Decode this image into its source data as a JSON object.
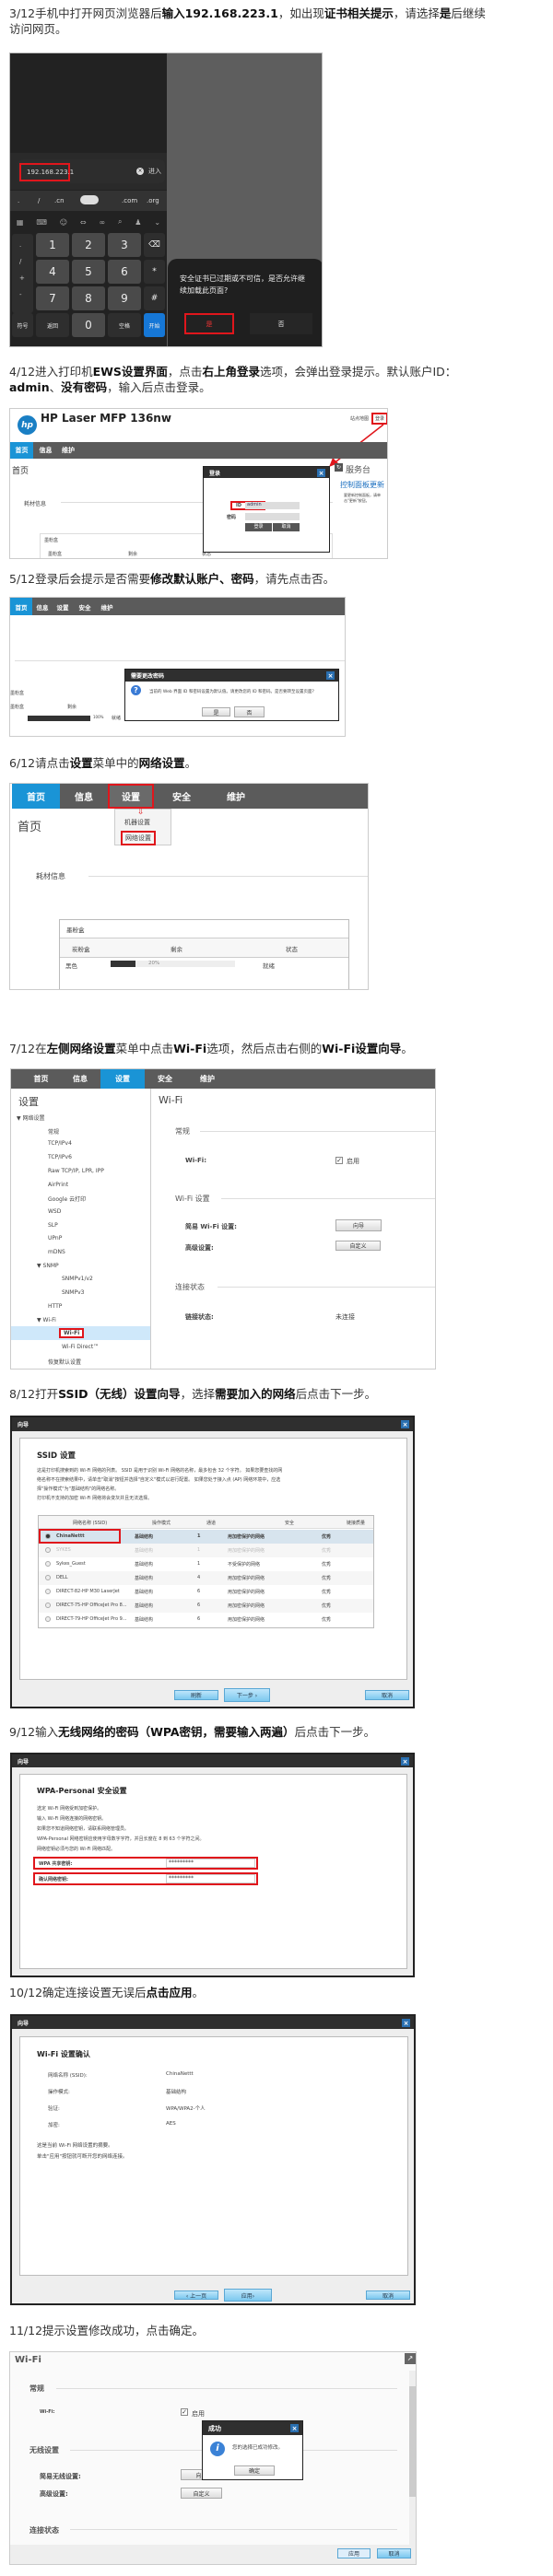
{
  "steps": [
    {
      "parts": [
        {
          "text": "3/12手机中打开网页浏览器后"
        },
        {
          "text": "输入192.168.223.1",
          "bold": true
        },
        {
          "text": "，如出现"
        },
        {
          "text": "证书相关提示",
          "bold": true
        },
        {
          "text": "，请选择"
        },
        {
          "text": "是",
          "bold": true
        },
        {
          "text": "后继续访问网页。"
        }
      ]
    },
    {
      "parts": [
        {
          "text": "4/12进入打印机"
        },
        {
          "text": "EWS设置界面",
          "bold": true
        },
        {
          "text": "，点击"
        },
        {
          "text": "右上角登录",
          "bold": true
        },
        {
          "text": "选项，会弹出登录提示。默认账户ID："
        },
        {
          "text": "admin",
          "bold": true
        },
        {
          "text": "、"
        },
        {
          "text": "没有密码",
          "bold": true
        },
        {
          "text": "，输入后点击登录。"
        }
      ]
    },
    {
      "parts": [
        {
          "text": "5/12登录后会提示是否需要"
        },
        {
          "text": "修改默认账户、密码",
          "bold": true
        },
        {
          "text": "，请先点击否。"
        }
      ]
    },
    {
      "parts": [
        {
          "text": "6/12请点击"
        },
        {
          "text": "设置",
          "bold": true
        },
        {
          "text": "菜单中的"
        },
        {
          "text": "网络设置",
          "bold": true
        },
        {
          "text": "。"
        }
      ]
    },
    {
      "parts": [
        {
          "text": "7/12在"
        },
        {
          "text": "左侧网络设置",
          "bold": true
        },
        {
          "text": "菜单中点击"
        },
        {
          "text": "Wi-Fi",
          "bold": true
        },
        {
          "text": "选项，然后点击右侧的"
        },
        {
          "text": "Wi-Fi设置向导",
          "bold": true
        },
        {
          "text": "。"
        }
      ]
    },
    {
      "parts": [
        {
          "text": "8/12打开"
        },
        {
          "text": "SSID（无线）设置向导",
          "bold": true
        },
        {
          "text": "，选择"
        },
        {
          "text": "需要加入的网络",
          "bold": true
        },
        {
          "text": "后点击下一步。"
        }
      ]
    },
    {
      "parts": [
        {
          "text": "9/12输入"
        },
        {
          "text": "无线网络的密码（WPA密钥，需要输入两遍）",
          "bold": true
        },
        {
          "text": "后点击下一步。"
        }
      ]
    },
    {
      "parts": [
        {
          "text": "10/12确定连接设置无误后"
        },
        {
          "text": "点击应用",
          "bold": true
        },
        {
          "text": "。"
        }
      ]
    },
    {
      "parts": [
        {
          "text": "11/12提示设置修改成功，点击确定。"
        }
      ]
    }
  ],
  "phone": {
    "url": "192.168.223.1",
    "enter": "进入",
    "suggestions": [
      ".",
      "/",
      ".cn",
      ".com",
      ".org"
    ],
    "side_keys": [
      ".",
      "/",
      "+",
      "-"
    ],
    "keys": [
      [
        "1",
        "2",
        "3",
        "⌫"
      ],
      [
        "4",
        "5",
        "6",
        "*"
      ],
      [
        "7",
        "8",
        "9",
        "#"
      ]
    ],
    "bottom_keys": [
      "符号",
      "返回",
      "0",
      "空格",
      "开始"
    ],
    "dialog_text": "安全证书已过期或不可信，是否允许继续加载此页面?",
    "yes": "是",
    "no": "否",
    "accent": "#1677d6"
  },
  "ews_login": {
    "brand": "hp",
    "title": "HP Laser MFP 136nw",
    "sitemap": "站点地图",
    "login": "登录",
    "nav": [
      "首页",
      "信息",
      "维护"
    ],
    "page_title": "首页",
    "supplies": "耗材信息",
    "dialog_title": "登录",
    "id_label": "ID",
    "id_value": "admin",
    "pw_label": "密码",
    "login_btn": "登录",
    "cancel_btn": "取消",
    "toner_box": "墨粉盒",
    "cols": [
      "墨粉盒",
      "剩余",
      "状态"
    ],
    "side_title": "服务台",
    "side_link": "控制面板更新",
    "side_text": "要更新控制面板，请单击\"更新\"按钮。"
  },
  "ews_change": {
    "nav": [
      "首页",
      "信息",
      "设置",
      "安全",
      "维护"
    ],
    "dialog_title": "需要更改密码",
    "message": "当前的 Web 界面 ID 和密码设置为默认值。请更改您的 ID 和密码。是否要转至设置页面?",
    "yes": "是",
    "no": "否",
    "toner_box": "墨粉盒",
    "cols": [
      "墨粉盒",
      "剩余",
      "状态"
    ],
    "row": [
      "黑色",
      "100%",
      "就绪"
    ]
  },
  "ews_menu": {
    "nav": [
      "首页",
      "信息",
      "设置",
      "安全",
      "维护"
    ],
    "menu": [
      "机器设置",
      "网络设置"
    ],
    "page_title": "首页",
    "supplies": "耗材信息",
    "toner_box": "墨粉盒",
    "cols": [
      "炭粉盒",
      "剩余",
      "状态"
    ],
    "row": {
      "color": "黑色",
      "remaining": "20%",
      "status": "就绪"
    },
    "toner_level": 0.2
  },
  "ews_wifi": {
    "nav": [
      "首页",
      "信息",
      "设置",
      "安全",
      "维护"
    ],
    "left_title": "设置",
    "tree": [
      {
        "label": "▼  网络设置",
        "level": 0
      },
      {
        "label": "常规",
        "level": 1
      },
      {
        "label": "TCP/IPv4",
        "level": 1
      },
      {
        "label": "TCP/IPv6",
        "level": 1
      },
      {
        "label": "Raw TCP/IP, LPR, IPP",
        "level": 1
      },
      {
        "label": "AirPrint",
        "level": 1
      },
      {
        "label": "Google 云打印",
        "level": 1
      },
      {
        "label": "WSD",
        "level": 1
      },
      {
        "label": "SLP",
        "level": 1
      },
      {
        "label": "UPnP",
        "level": 1
      },
      {
        "label": "mDNS",
        "level": 1
      },
      {
        "label": "▼  SNMP",
        "level": 0.6
      },
      {
        "label": "SNMPv1/v2",
        "level": 2
      },
      {
        "label": "SNMPv3",
        "level": 2
      },
      {
        "label": "HTTP",
        "level": 1
      },
      {
        "label": "▼  Wi-Fi",
        "level": 0.6
      },
      {
        "label": "Wi-Fi",
        "level": 2,
        "selected": true
      },
      {
        "label": "Wi-Fi Direct™",
        "level": 2
      },
      {
        "label": "恢复默认设置",
        "level": 1
      }
    ],
    "title": "Wi-Fi",
    "general": "常规",
    "wifi_label": "Wi-Fi:",
    "enable": "启用",
    "wifi_settings": "Wi-Fi 设置",
    "easy_label": "简易 Wi-Fi 设置:",
    "wizard_btn": "向导",
    "advanced_label": "高级设置:",
    "custom_btn": "自定义",
    "conn_status": "连接状态",
    "link_label": "链接状态:",
    "link_value": "未连接"
  },
  "ssid_wizard": {
    "window_title": "向导",
    "title": "SSID 设置",
    "desc": [
      "这是打印机搜索到的 Wi-Fi 网络的列表。 SSID 是用于识别 Wi-Fi 网络的名称，最多包含 32 个字符。 如果您要查找的网",
      "络名称不在搜索结果中，请单击\"取消\"按钮并选择\"自定义\"模式以进行配置。 如果您处于接入点 (AP) 网络环境中，应选",
      "择\"操作模式\"为\"基础结构\"的网络名称。",
      "打印机不支持的加密 Wi-Fi 网络将会变灰并且无法选择。"
    ],
    "columns": [
      "网络名称 (SSID)",
      "操作模式",
      "通道",
      "安全",
      "链接质量"
    ],
    "rows": [
      {
        "ssid": "ChinaNettt",
        "mode": "基础结构",
        "channel": "1",
        "security": "用加密保护的网络",
        "quality": "优秀",
        "selected": true
      },
      {
        "ssid": "SYKES",
        "mode": "基础结构",
        "channel": "1",
        "security": "用加密保护的网络",
        "quality": "优秀",
        "disabled": true
      },
      {
        "ssid": "Sykes_Guest",
        "mode": "基础结构",
        "channel": "1",
        "security": "不受保护的网络",
        "quality": "优秀"
      },
      {
        "ssid": "DELL",
        "mode": "基础结构",
        "channel": "4",
        "security": "用加密保护的网络",
        "quality": "优秀"
      },
      {
        "ssid": "DIRECT-82-HP M30 LaserJet",
        "mode": "基础结构",
        "channel": "6",
        "security": "用加密保护的网络",
        "quality": "优秀"
      },
      {
        "ssid": "DIRECT-75-HP OfficeJet Pro 8...",
        "mode": "基础结构",
        "channel": "6",
        "security": "用加密保护的网络",
        "quality": "优秀"
      },
      {
        "ssid": "DIRECT-79-HP OfficeJet Pro 9...",
        "mode": "基础结构",
        "channel": "6",
        "security": "用加密保护的网络",
        "quality": "优秀"
      }
    ],
    "refresh": "刷新",
    "next": "下一步 ›",
    "cancel": "取消"
  },
  "wpa_wizard": {
    "window_title": "向导",
    "title": "WPA-Personal 安全设置",
    "desc": [
      "选定 Wi-Fi 网络受到加密保护。",
      "输入 Wi-Fi 网络连接的网络密钥。",
      "如果您不知道网络密钥，请联系网络管理员。",
      "WPA-Personal 网络密钥应使用字母数字字符，并且长度在 8 到 63 个字符之间。",
      "网络密钥必须与您的 Wi-Fi 网络匹配。"
    ],
    "key_label": "WPA 共享密钥:",
    "key_value": "*********",
    "confirm_label": "确认网络密钥:",
    "confirm_value": "*********"
  },
  "confirm_wizard": {
    "window_title": "向导",
    "title": "Wi-Fi 设置确认",
    "rows": [
      {
        "label": "网络名称 (SSID):",
        "value": "ChinaNettt"
      },
      {
        "label": "操作模式:",
        "value": "基础结构"
      },
      {
        "label": "验证:",
        "value": "WPA/WPA2-个人"
      },
      {
        "label": "加密:",
        "value": "AES"
      }
    ],
    "note": [
      "这是当前 Wi-Fi 网络设置的摘要。",
      "单击\"应用\"按钮就可断开您的网络连接。"
    ],
    "prev": "‹ 上一页",
    "apply": "应用›",
    "cancel": "取消"
  },
  "success": {
    "title": "Wi-Fi",
    "general": "常规",
    "wifi_label": "Wi-Fi:",
    "enable": "启用",
    "wireless": "无线设置",
    "easy_label": "简易无线设置:",
    "easy_btn": "向导",
    "advanced_label": "高级设置:",
    "custom_btn": "自定义",
    "conn_status": "连接状态",
    "dialog_title": "成功",
    "dialog_msg": "您的选择已成功修改。",
    "ok": "确定",
    "apply": "应用",
    "cancel": "取消"
  }
}
